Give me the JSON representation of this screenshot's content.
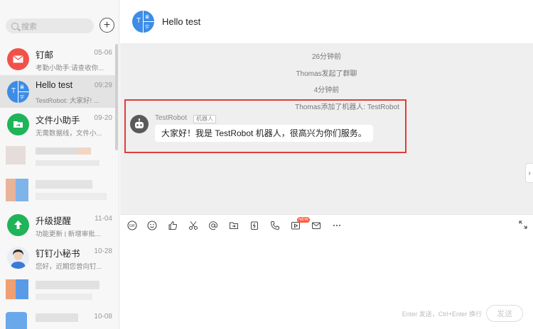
{
  "sidebar": {
    "search_placeholder": "搜索",
    "add_symbol": "+",
    "conversations": [
      {
        "title": "钉邮",
        "preview": "考勤小助手:请查收你...",
        "time": "05-06",
        "icon": "mail-icon",
        "color": "#f0524a"
      },
      {
        "title": "Hello test",
        "preview": "TestRobot: 大家好! ...",
        "time": "09:29",
        "icon": "group-avatar",
        "color": "#3d8ce6",
        "active": true,
        "avatar_letters": [
          "T",
          "巢",
          "宇"
        ]
      },
      {
        "title": "文件小助手",
        "preview": "无需数据线，文件小...",
        "time": "09-20",
        "icon": "folder-icon",
        "color": "#1fb45a"
      },
      {
        "title": "升级提醒",
        "preview": "功能更新 | 新增审批...",
        "time": "11-04",
        "icon": "upgrade-arrow-icon",
        "color": "#1fb45a"
      },
      {
        "title": "钉钉小秘书",
        "preview": "您好，近期您曾向钉...",
        "time": "10-28",
        "icon": "secretary-photo",
        "color": "#e8eef5"
      },
      {
        "title": "",
        "preview": "",
        "time": "10-08"
      }
    ]
  },
  "chat": {
    "header_title": "Hello test",
    "header_avatar_letters": [
      "T",
      "巢",
      "宇"
    ],
    "system_messages": [
      "26分钟前",
      "Thomas发起了群聊",
      "4分钟前",
      "Thomas添加了机器人: TestRobot"
    ],
    "message": {
      "sender": "TestRobot",
      "tag": "机器人",
      "text": "大家好！我是 TestRobot 机器人，很高兴为你们服务。"
    }
  },
  "composer": {
    "tools": [
      "gif-icon",
      "emoji-icon",
      "thumbs-up-icon",
      "scissors-icon",
      "at-icon",
      "folder-icon",
      "ding-icon",
      "phone-icon",
      "live-icon",
      "mail-icon",
      "more-icon"
    ],
    "new_badge": "NEW",
    "hint": "Enter 发送，Ctrl+Enter 换行",
    "send_label": "发送"
  },
  "colors": {
    "accent": "#3d8ce6",
    "highlight": "#e23b3b"
  }
}
